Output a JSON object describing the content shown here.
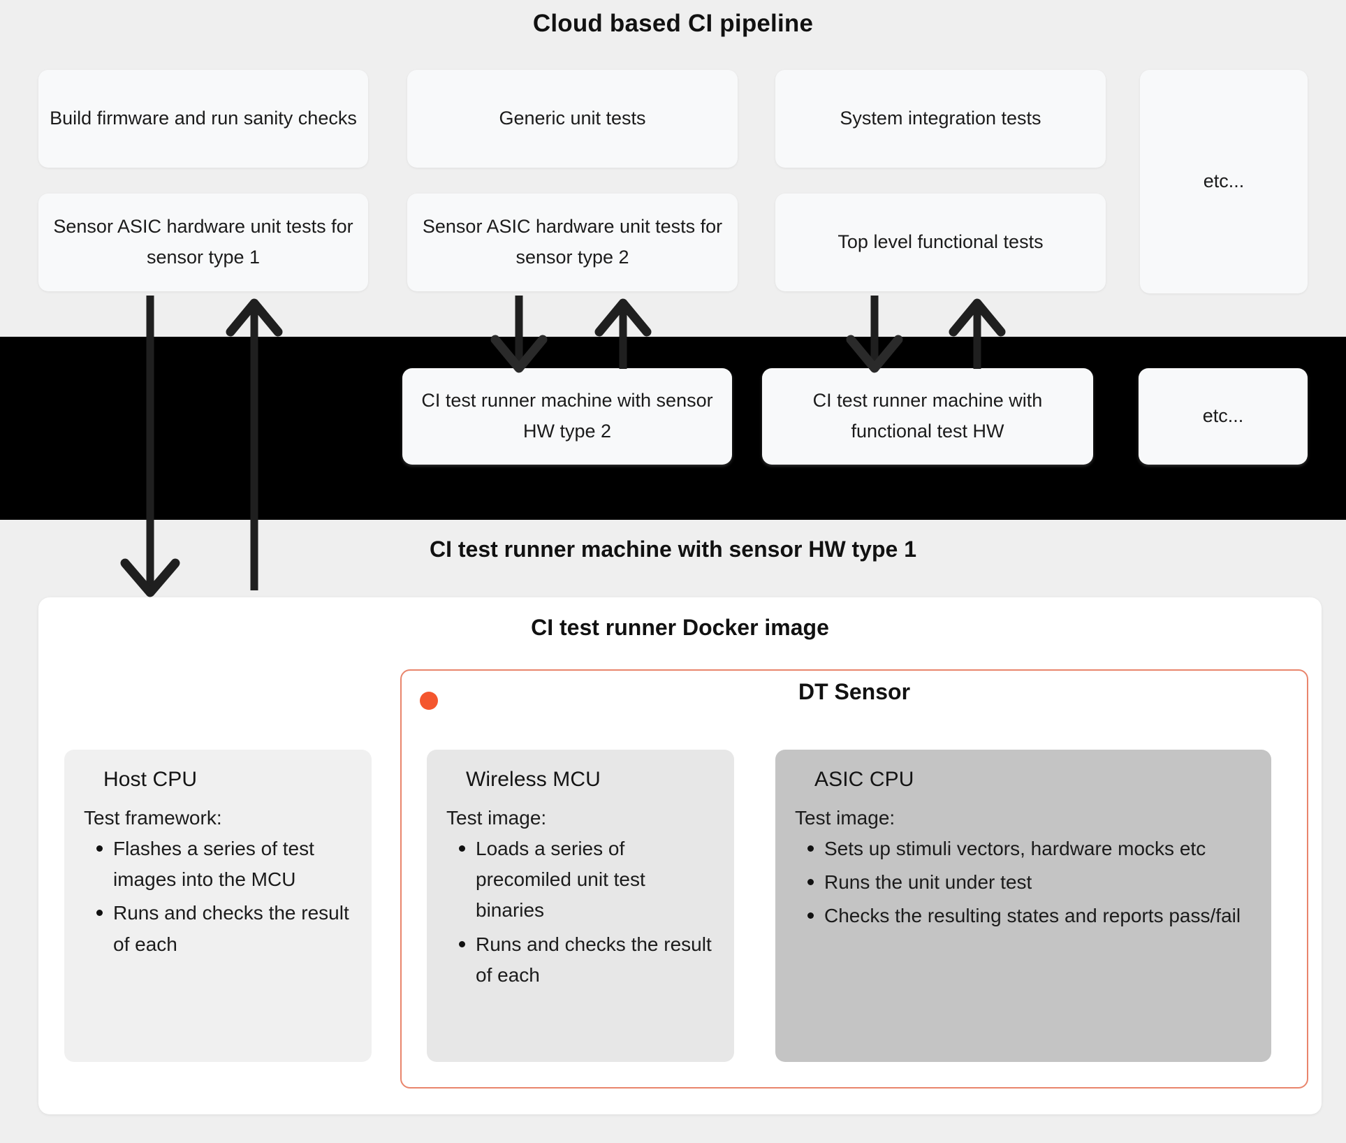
{
  "pipeline": {
    "title": "Cloud based CI pipeline",
    "stages": [
      {
        "id": "build",
        "label": "Build firmware and run sanity checks"
      },
      {
        "id": "generic",
        "label": "Generic unit tests"
      },
      {
        "id": "sysint",
        "label": "System integration tests"
      },
      {
        "id": "etc_top",
        "label": "etc..."
      },
      {
        "id": "asic1",
        "label": "Sensor ASIC hardware unit tests for sensor type 1"
      },
      {
        "id": "asic2",
        "label": "Sensor ASIC hardware unit tests for sensor type 2"
      },
      {
        "id": "toplevel",
        "label": "Top level functional tests"
      }
    ]
  },
  "runners": {
    "items": [
      {
        "id": "hw2",
        "label": "CI test runner machine with sensor HW type 2"
      },
      {
        "id": "func",
        "label": "CI test runner machine with functional test HW"
      },
      {
        "id": "etc",
        "label": "etc..."
      }
    ]
  },
  "runner_type1": {
    "title": "CI test runner machine with sensor HW type 1",
    "docker_title": "CI test runner Docker image",
    "dt_sensor": {
      "title": "DT Sensor",
      "dot_color": "#f4562e",
      "border_color": "#e9856c"
    },
    "cores": [
      {
        "id": "host",
        "title": "Host CPU",
        "subtitle": "Test framework:",
        "bullets": [
          "Flashes a series of test images into the MCU",
          "Runs and checks the result of each"
        ]
      },
      {
        "id": "wireless",
        "title": "Wireless MCU",
        "subtitle": "Test image:",
        "bullets": [
          "Loads a series of precomiled unit test binaries",
          "Runs and checks the result of each"
        ]
      },
      {
        "id": "asic",
        "title": "ASIC CPU",
        "subtitle": "Test image:",
        "bullets": [
          "Sets up stimuli vectors, hardware mocks etc",
          "Runs the unit under test",
          "Checks the resulting states and reports pass/fail"
        ]
      }
    ]
  },
  "colors": {
    "page_background": "#efefef",
    "band": "#000000",
    "card_light": "#f8f9fa",
    "accent": "#f4562e",
    "arrow": "#1f1f1f"
  }
}
